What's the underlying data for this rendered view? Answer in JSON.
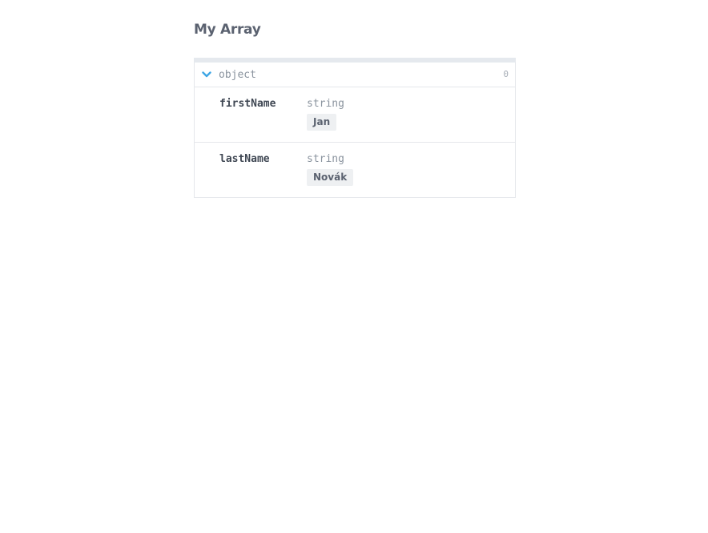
{
  "page": {
    "title": "My Array"
  },
  "schema": {
    "object_type": "object",
    "count": "0",
    "properties": [
      {
        "name": "firstName",
        "type": "string",
        "value": "Jan"
      },
      {
        "name": "lastName",
        "type": "string",
        "value": "Novák"
      }
    ]
  },
  "colors": {
    "accent": "#3ea6e5",
    "muted_text": "#8a939e",
    "heading": "#5b6270",
    "border": "#e5e7eb",
    "badge_bg": "#eef0f2"
  },
  "icons": {
    "expand": "chevron-down-icon"
  }
}
